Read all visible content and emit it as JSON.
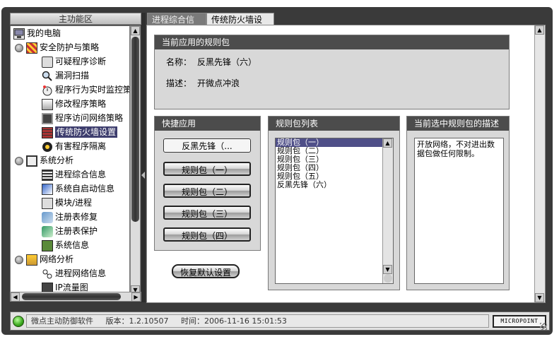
{
  "sidebar": {
    "header": "主功能区",
    "tree": [
      {
        "label": "我的电脑",
        "icon": "computer-icon"
      },
      {
        "label": "安全防护与策略",
        "icon": "security-policy-icon"
      },
      {
        "label": "可疑程序诊断",
        "icon": "diagnosis-icon"
      },
      {
        "label": "漏洞扫描",
        "icon": "magnifier-icon"
      },
      {
        "label": "程序行为实时监控策",
        "icon": "monitor-icon"
      },
      {
        "label": "修改程序策略",
        "icon": "edit-policy-icon"
      },
      {
        "label": "程序访问网络策略",
        "icon": "network-policy-icon"
      },
      {
        "label": "传统防火墙设置",
        "icon": "firewall-icon"
      },
      {
        "label": "有害程序隔离",
        "icon": "quarantine-icon"
      },
      {
        "label": "系统分析",
        "icon": "system-analysis-icon"
      },
      {
        "label": "进程综合信息",
        "icon": "process-icon"
      },
      {
        "label": "系统自启动信息",
        "icon": "startup-icon"
      },
      {
        "label": "模块/进程",
        "icon": "module-icon"
      },
      {
        "label": "注册表修复",
        "icon": "registry-repair-icon"
      },
      {
        "label": "注册表保护",
        "icon": "registry-protect-icon"
      },
      {
        "label": "系统信息",
        "icon": "system-info-icon"
      },
      {
        "label": "网络分析",
        "icon": "network-analysis-icon"
      },
      {
        "label": "进程网络信息",
        "icon": "process-network-icon"
      },
      {
        "label": "IP流量图",
        "icon": "traffic-chart-icon"
      }
    ]
  },
  "tabs": [
    {
      "label": "进程综合信息",
      "active": false
    },
    {
      "label": "传统防火墙设置",
      "active": true
    }
  ],
  "current_package": {
    "title": "当前应用的规则包",
    "name_label": "名称：",
    "name_value": "反黑先锋（六）",
    "desc_label": "描述：",
    "desc_value": "开微点冲浪"
  },
  "quick_apply": {
    "title": "快捷应用",
    "buttons": [
      "反黑先锋（...",
      "规则包（一）",
      "规则包（二）",
      "规则包（三）",
      "规则包（四）"
    ],
    "restore_label": "恢复默认设置"
  },
  "package_list": {
    "title": "规则包列表",
    "items": [
      "规则包（一）",
      "规则包（二）",
      "规则包（三）",
      "规则包（四）",
      "规则包（五）",
      "反黑先锋（六）"
    ],
    "selected_index": 0
  },
  "selected_desc": {
    "title": "当前选中规则包的描述",
    "text": "开放网络，不对进出数据包做任何限制。"
  },
  "status": {
    "product": "微点主动防御软件",
    "version_label": "版本：",
    "version": "1.2.10507",
    "time_label": "时间：",
    "time": "2006-11-16 15:01:53",
    "brand": "MICROPOINT"
  },
  "colors": {
    "panel_title_bg": "#4c4c4c",
    "selection": "#3e3e6e",
    "status_led": "#3aa71e"
  }
}
